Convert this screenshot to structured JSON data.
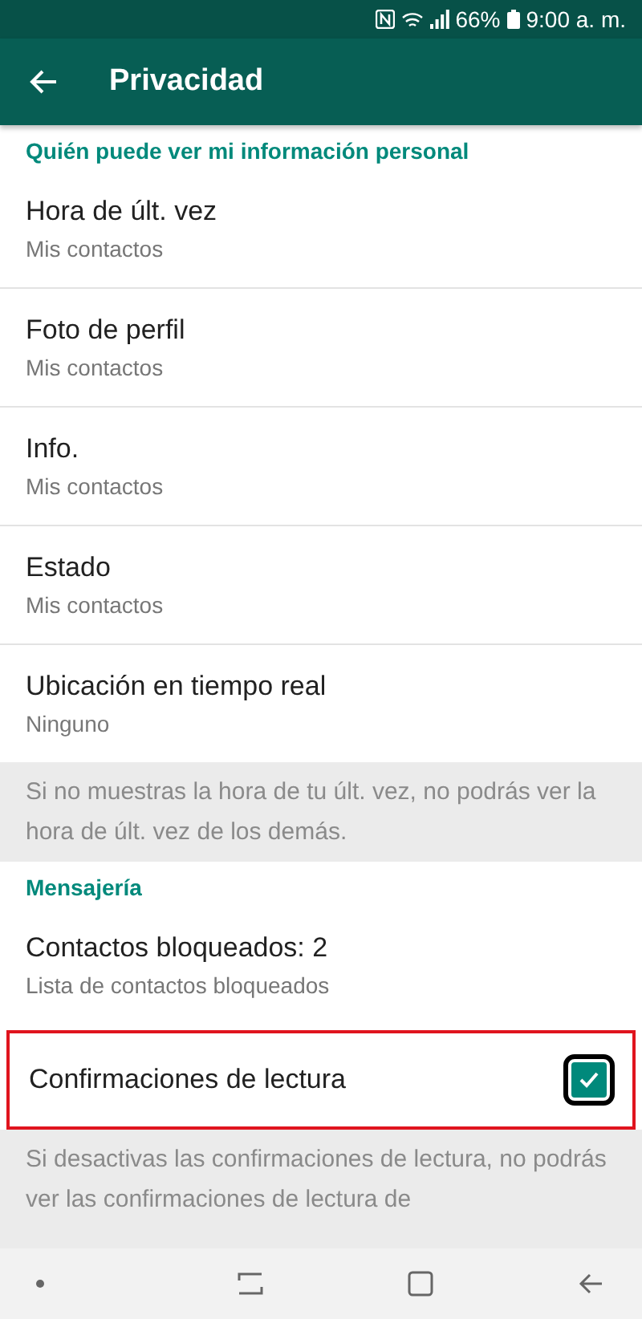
{
  "status_bar": {
    "battery": "66%",
    "time": "9:00 a. m."
  },
  "toolbar": {
    "title": "Privacidad"
  },
  "sections": [
    {
      "header": "Quién puede ver mi información personal",
      "items": [
        {
          "kind": "value",
          "title": "Hora de últ. vez",
          "subtitle": "Mis contactos"
        },
        {
          "kind": "value",
          "title": "Foto de perfil",
          "subtitle": "Mis contactos"
        },
        {
          "kind": "value",
          "title": "Info.",
          "subtitle": "Mis contactos"
        },
        {
          "kind": "value",
          "title": "Estado",
          "subtitle": "Mis contactos"
        },
        {
          "kind": "value",
          "title": "Ubicación en tiempo real",
          "subtitle": "Ninguno"
        }
      ],
      "footer": "Si no muestras la hora de tu últ. vez, no podrás ver la hora de últ. vez de los demás."
    },
    {
      "header": "Mensajería",
      "items": [
        {
          "kind": "value",
          "title": "Contactos bloqueados: 2",
          "subtitle": "Lista de contactos bloqueados"
        },
        {
          "kind": "checkbox",
          "title": "Confirmaciones de lectura",
          "checked": true,
          "highlighted": true
        }
      ],
      "footer": "Si desactivas las confirmaciones de lectura, no podrás ver las confirmaciones de lectura de"
    }
  ]
}
